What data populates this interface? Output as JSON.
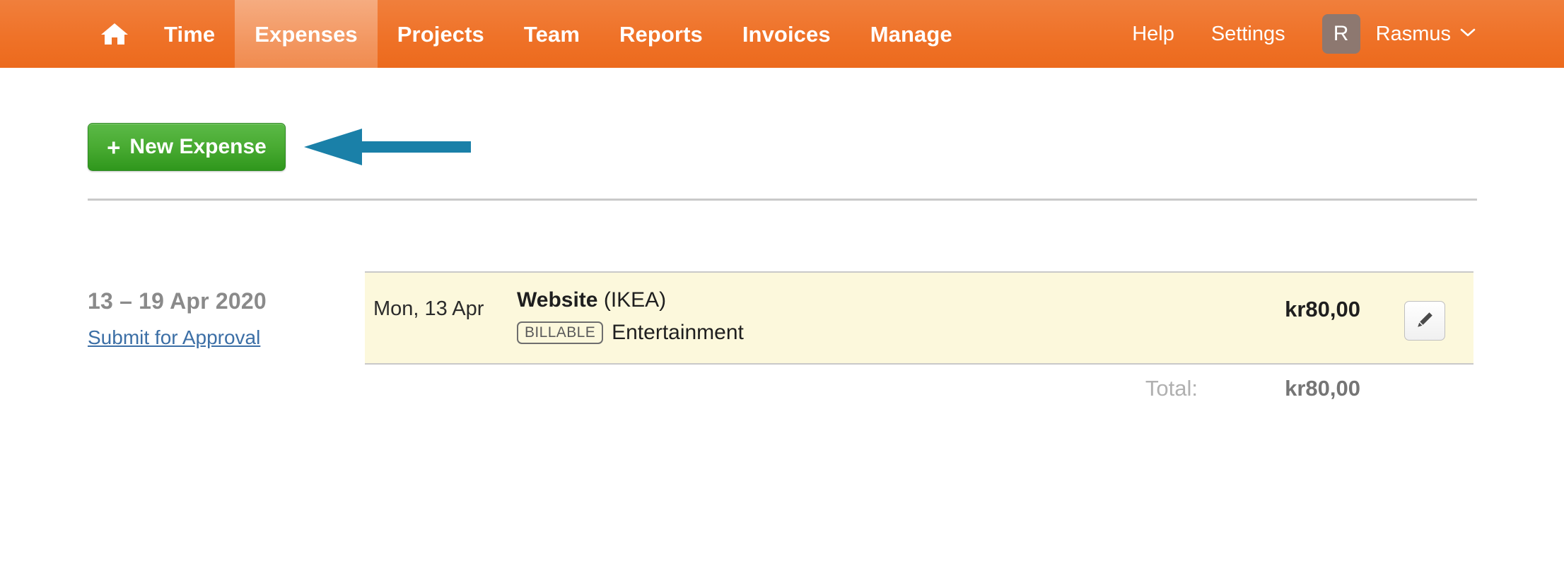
{
  "navbar": {
    "home_icon": "home-icon",
    "items": [
      {
        "label": "Time",
        "active": false
      },
      {
        "label": "Expenses",
        "active": true
      },
      {
        "label": "Projects",
        "active": false
      },
      {
        "label": "Team",
        "active": false
      },
      {
        "label": "Reports",
        "active": false
      },
      {
        "label": "Invoices",
        "active": false
      },
      {
        "label": "Manage",
        "active": false
      }
    ],
    "help_label": "Help",
    "settings_label": "Settings",
    "avatar_initial": "R",
    "user_name": "Rasmus",
    "caret_icon": "chevron-down-icon",
    "background_color": "#ef7228",
    "active_tab_color": "#f49a63"
  },
  "toolbar": {
    "new_expense_label": "New Expense",
    "new_expense_plus": "+",
    "new_expense_color": "#3fa32b"
  },
  "annotation": {
    "arrow_icon": "left-arrow-annotation",
    "arrow_color": "#1a80a8"
  },
  "week": {
    "range_label": "13 – 19 Apr 2020",
    "submit_link_label": "Submit for Approval",
    "submit_link_color": "#3c6fa6"
  },
  "expenses": [
    {
      "date": "Mon, 13 Apr",
      "project": "Website",
      "client": "(IKEA)",
      "billable_badge": "BILLABLE",
      "category": "Entertainment",
      "amount": "kr80,00",
      "row_color": "#fcf8dc",
      "edit_icon": "pencil-icon"
    }
  ],
  "totals": {
    "label": "Total:",
    "amount": "kr80,00"
  }
}
